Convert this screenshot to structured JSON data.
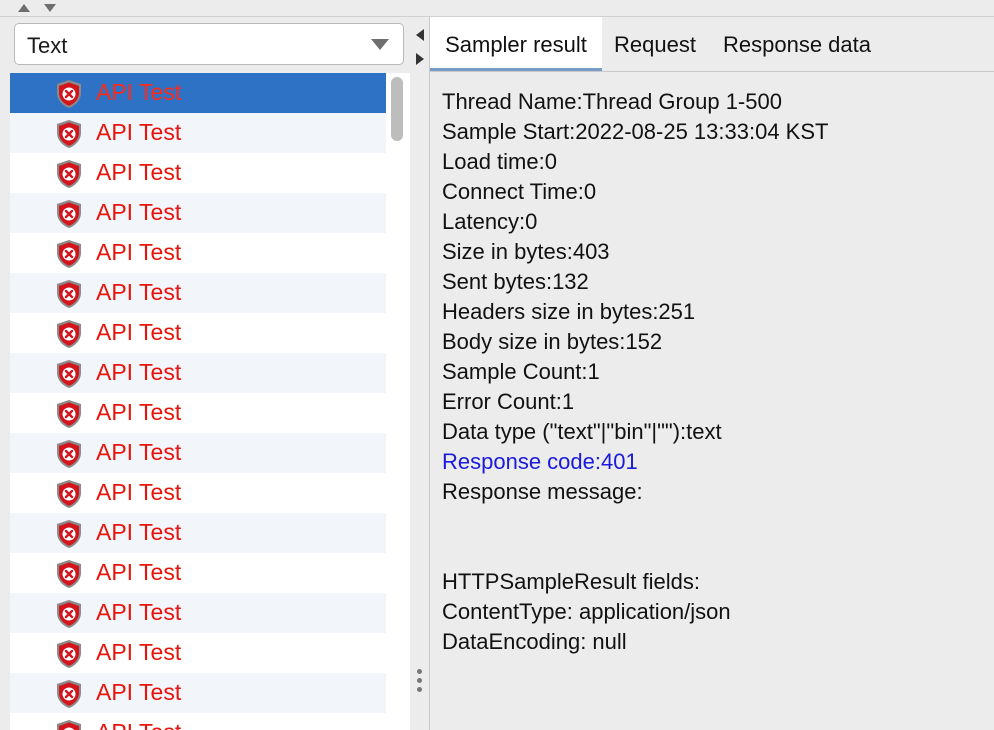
{
  "top_bar": {
    "collapse_up_icon": "triangle-up",
    "collapse_down_icon": "triangle-down"
  },
  "left_panel": {
    "renderer_select": {
      "value": "Text"
    },
    "results": [
      {
        "label": "API Test",
        "status": "error",
        "selected": true
      },
      {
        "label": "API Test",
        "status": "error",
        "selected": false
      },
      {
        "label": "API Test",
        "status": "error",
        "selected": false
      },
      {
        "label": "API Test",
        "status": "error",
        "selected": false
      },
      {
        "label": "API Test",
        "status": "error",
        "selected": false
      },
      {
        "label": "API Test",
        "status": "error",
        "selected": false
      },
      {
        "label": "API Test",
        "status": "error",
        "selected": false
      },
      {
        "label": "API Test",
        "status": "error",
        "selected": false
      },
      {
        "label": "API Test",
        "status": "error",
        "selected": false
      },
      {
        "label": "API Test",
        "status": "error",
        "selected": false
      },
      {
        "label": "API Test",
        "status": "error",
        "selected": false
      },
      {
        "label": "API Test",
        "status": "error",
        "selected": false
      },
      {
        "label": "API Test",
        "status": "error",
        "selected": false
      },
      {
        "label": "API Test",
        "status": "error",
        "selected": false
      },
      {
        "label": "API Test",
        "status": "error",
        "selected": false
      },
      {
        "label": "API Test",
        "status": "error",
        "selected": false
      },
      {
        "label": "API Test",
        "status": "error",
        "selected": false
      }
    ],
    "colors": {
      "selected_row": "#2d72c4",
      "error_text": "#e8140c",
      "alt_row": "#f2f5fa"
    }
  },
  "right_panel": {
    "tabs": [
      {
        "label": "Sampler result",
        "active": true
      },
      {
        "label": "Request",
        "active": false
      },
      {
        "label": "Response data",
        "active": false
      }
    ],
    "details": {
      "thread_name": "Thread Name:Thread Group 1-500",
      "sample_start": "Sample Start:2022-08-25 13:33:04 KST",
      "load_time": "Load time:0",
      "connect_time": "Connect Time:0",
      "latency": "Latency:0",
      "size_bytes": "Size in bytes:403",
      "sent_bytes": "Sent bytes:132",
      "headers_size": "Headers size in bytes:251",
      "body_size": "Body size in bytes:152",
      "sample_count": "Sample Count:1",
      "error_count": "Error Count:1",
      "data_type": "Data type (\"text\"|\"bin\"|\"\"):text",
      "response_code": "Response code:401",
      "response_message": "Response message:",
      "http_fields_header": "HTTPSampleResult fields:",
      "content_type": "ContentType: application/json",
      "data_encoding": "DataEncoding: null"
    },
    "colors": {
      "response_code": "#1a1adc"
    }
  }
}
